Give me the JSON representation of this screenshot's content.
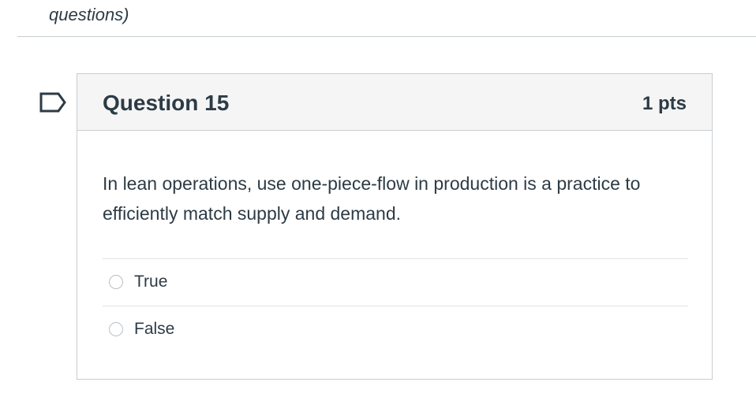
{
  "quiz": {
    "header_fragment": "questions)"
  },
  "question": {
    "flag_icon": "bookmark-flag-icon",
    "title": "Question 15",
    "points": "1 pts",
    "text": "In lean operations, use one-piece-flow in production is a practice to efficiently match supply and demand.",
    "answers": [
      {
        "label": "True"
      },
      {
        "label": "False"
      }
    ]
  },
  "colors": {
    "text": "#2d3b45",
    "border": "#c7cdd1",
    "header_bg": "#f5f5f5",
    "divider": "#dfe3e6"
  }
}
